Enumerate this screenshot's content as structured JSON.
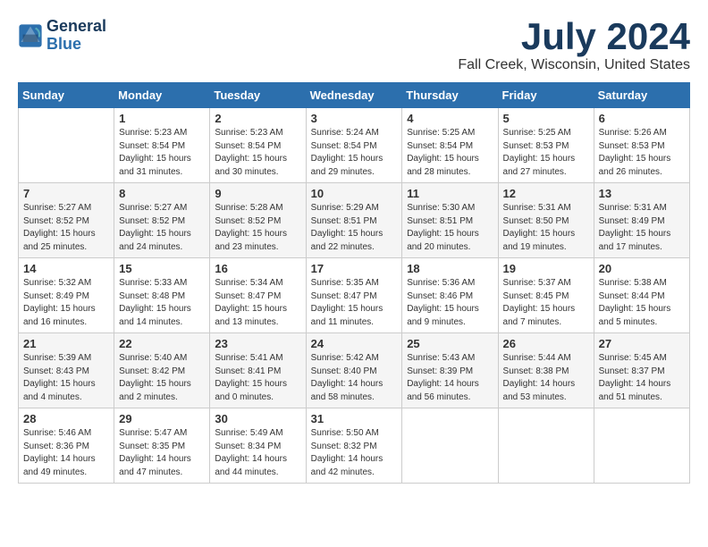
{
  "header": {
    "logo_line1": "General",
    "logo_line2": "Blue",
    "month_year": "July 2024",
    "location": "Fall Creek, Wisconsin, United States"
  },
  "days_of_week": [
    "Sunday",
    "Monday",
    "Tuesday",
    "Wednesday",
    "Thursday",
    "Friday",
    "Saturday"
  ],
  "weeks": [
    [
      {
        "day": "",
        "info": ""
      },
      {
        "day": "1",
        "info": "Sunrise: 5:23 AM\nSunset: 8:54 PM\nDaylight: 15 hours\nand 31 minutes."
      },
      {
        "day": "2",
        "info": "Sunrise: 5:23 AM\nSunset: 8:54 PM\nDaylight: 15 hours\nand 30 minutes."
      },
      {
        "day": "3",
        "info": "Sunrise: 5:24 AM\nSunset: 8:54 PM\nDaylight: 15 hours\nand 29 minutes."
      },
      {
        "day": "4",
        "info": "Sunrise: 5:25 AM\nSunset: 8:54 PM\nDaylight: 15 hours\nand 28 minutes."
      },
      {
        "day": "5",
        "info": "Sunrise: 5:25 AM\nSunset: 8:53 PM\nDaylight: 15 hours\nand 27 minutes."
      },
      {
        "day": "6",
        "info": "Sunrise: 5:26 AM\nSunset: 8:53 PM\nDaylight: 15 hours\nand 26 minutes."
      }
    ],
    [
      {
        "day": "7",
        "info": "Sunrise: 5:27 AM\nSunset: 8:52 PM\nDaylight: 15 hours\nand 25 minutes."
      },
      {
        "day": "8",
        "info": "Sunrise: 5:27 AM\nSunset: 8:52 PM\nDaylight: 15 hours\nand 24 minutes."
      },
      {
        "day": "9",
        "info": "Sunrise: 5:28 AM\nSunset: 8:52 PM\nDaylight: 15 hours\nand 23 minutes."
      },
      {
        "day": "10",
        "info": "Sunrise: 5:29 AM\nSunset: 8:51 PM\nDaylight: 15 hours\nand 22 minutes."
      },
      {
        "day": "11",
        "info": "Sunrise: 5:30 AM\nSunset: 8:51 PM\nDaylight: 15 hours\nand 20 minutes."
      },
      {
        "day": "12",
        "info": "Sunrise: 5:31 AM\nSunset: 8:50 PM\nDaylight: 15 hours\nand 19 minutes."
      },
      {
        "day": "13",
        "info": "Sunrise: 5:31 AM\nSunset: 8:49 PM\nDaylight: 15 hours\nand 17 minutes."
      }
    ],
    [
      {
        "day": "14",
        "info": "Sunrise: 5:32 AM\nSunset: 8:49 PM\nDaylight: 15 hours\nand 16 minutes."
      },
      {
        "day": "15",
        "info": "Sunrise: 5:33 AM\nSunset: 8:48 PM\nDaylight: 15 hours\nand 14 minutes."
      },
      {
        "day": "16",
        "info": "Sunrise: 5:34 AM\nSunset: 8:47 PM\nDaylight: 15 hours\nand 13 minutes."
      },
      {
        "day": "17",
        "info": "Sunrise: 5:35 AM\nSunset: 8:47 PM\nDaylight: 15 hours\nand 11 minutes."
      },
      {
        "day": "18",
        "info": "Sunrise: 5:36 AM\nSunset: 8:46 PM\nDaylight: 15 hours\nand 9 minutes."
      },
      {
        "day": "19",
        "info": "Sunrise: 5:37 AM\nSunset: 8:45 PM\nDaylight: 15 hours\nand 7 minutes."
      },
      {
        "day": "20",
        "info": "Sunrise: 5:38 AM\nSunset: 8:44 PM\nDaylight: 15 hours\nand 5 minutes."
      }
    ],
    [
      {
        "day": "21",
        "info": "Sunrise: 5:39 AM\nSunset: 8:43 PM\nDaylight: 15 hours\nand 4 minutes."
      },
      {
        "day": "22",
        "info": "Sunrise: 5:40 AM\nSunset: 8:42 PM\nDaylight: 15 hours\nand 2 minutes."
      },
      {
        "day": "23",
        "info": "Sunrise: 5:41 AM\nSunset: 8:41 PM\nDaylight: 15 hours\nand 0 minutes."
      },
      {
        "day": "24",
        "info": "Sunrise: 5:42 AM\nSunset: 8:40 PM\nDaylight: 14 hours\nand 58 minutes."
      },
      {
        "day": "25",
        "info": "Sunrise: 5:43 AM\nSunset: 8:39 PM\nDaylight: 14 hours\nand 56 minutes."
      },
      {
        "day": "26",
        "info": "Sunrise: 5:44 AM\nSunset: 8:38 PM\nDaylight: 14 hours\nand 53 minutes."
      },
      {
        "day": "27",
        "info": "Sunrise: 5:45 AM\nSunset: 8:37 PM\nDaylight: 14 hours\nand 51 minutes."
      }
    ],
    [
      {
        "day": "28",
        "info": "Sunrise: 5:46 AM\nSunset: 8:36 PM\nDaylight: 14 hours\nand 49 minutes."
      },
      {
        "day": "29",
        "info": "Sunrise: 5:47 AM\nSunset: 8:35 PM\nDaylight: 14 hours\nand 47 minutes."
      },
      {
        "day": "30",
        "info": "Sunrise: 5:49 AM\nSunset: 8:34 PM\nDaylight: 14 hours\nand 44 minutes."
      },
      {
        "day": "31",
        "info": "Sunrise: 5:50 AM\nSunset: 8:32 PM\nDaylight: 14 hours\nand 42 minutes."
      },
      {
        "day": "",
        "info": ""
      },
      {
        "day": "",
        "info": ""
      },
      {
        "day": "",
        "info": ""
      }
    ]
  ]
}
